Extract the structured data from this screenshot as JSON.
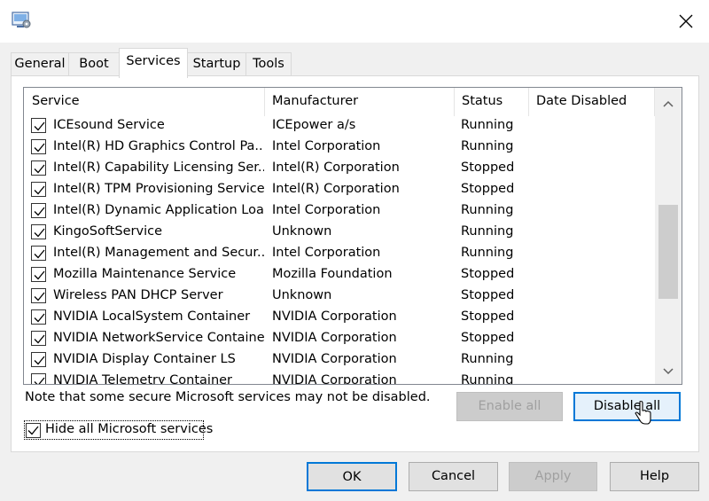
{
  "window": {
    "icons": {
      "app": "system-configuration-icon",
      "close": "close-icon"
    }
  },
  "tabs": [
    {
      "label": "General",
      "active": false
    },
    {
      "label": "Boot",
      "active": false
    },
    {
      "label": "Services",
      "active": true
    },
    {
      "label": "Startup",
      "active": false
    },
    {
      "label": "Tools",
      "active": false
    }
  ],
  "services_table": {
    "columns": [
      "Service",
      "Manufacturer",
      "Status",
      "Date Disabled"
    ],
    "rows": [
      {
        "checked": true,
        "service": "ICEsound Service",
        "manufacturer": "ICEpower a/s",
        "status": "Running",
        "date_disabled": ""
      },
      {
        "checked": true,
        "service": "Intel(R) HD Graphics Control Pa...",
        "manufacturer": "Intel Corporation",
        "status": "Running",
        "date_disabled": ""
      },
      {
        "checked": true,
        "service": "Intel(R) Capability Licensing Ser...",
        "manufacturer": "Intel(R) Corporation",
        "status": "Stopped",
        "date_disabled": ""
      },
      {
        "checked": true,
        "service": "Intel(R) TPM Provisioning Service",
        "manufacturer": "Intel(R) Corporation",
        "status": "Stopped",
        "date_disabled": ""
      },
      {
        "checked": true,
        "service": "Intel(R) Dynamic Application Loa...",
        "manufacturer": "Intel Corporation",
        "status": "Running",
        "date_disabled": ""
      },
      {
        "checked": true,
        "service": "KingoSoftService",
        "manufacturer": "Unknown",
        "status": "Running",
        "date_disabled": ""
      },
      {
        "checked": true,
        "service": "Intel(R) Management and Secur...",
        "manufacturer": "Intel Corporation",
        "status": "Running",
        "date_disabled": ""
      },
      {
        "checked": true,
        "service": "Mozilla Maintenance Service",
        "manufacturer": "Mozilla Foundation",
        "status": "Stopped",
        "date_disabled": ""
      },
      {
        "checked": true,
        "service": "Wireless PAN DHCP Server",
        "manufacturer": "Unknown",
        "status": "Stopped",
        "date_disabled": ""
      },
      {
        "checked": true,
        "service": "NVIDIA LocalSystem Container",
        "manufacturer": "NVIDIA Corporation",
        "status": "Stopped",
        "date_disabled": ""
      },
      {
        "checked": true,
        "service": "NVIDIA NetworkService Container",
        "manufacturer": "NVIDIA Corporation",
        "status": "Stopped",
        "date_disabled": ""
      },
      {
        "checked": true,
        "service": "NVIDIA Display Container LS",
        "manufacturer": "NVIDIA Corporation",
        "status": "Running",
        "date_disabled": ""
      },
      {
        "checked": true,
        "service": "NVIDIA Telemetry Container",
        "manufacturer": "NVIDIA Corporation",
        "status": "Running",
        "date_disabled": ""
      }
    ]
  },
  "note": "Note that some secure Microsoft services may not be disabled.",
  "enable_all": {
    "label": "Enable all",
    "enabled": false
  },
  "disable_all": {
    "label": "Disable all",
    "enabled": true
  },
  "hide_microsoft": {
    "label": "Hide all Microsoft services",
    "checked": true
  },
  "footer": {
    "ok": "OK",
    "cancel": "Cancel",
    "apply": "Apply",
    "help": "Help"
  },
  "colors": {
    "accent": "#0078d7",
    "disabled_text": "#a0a0a0",
    "window_bg": "#f0f0f0"
  }
}
